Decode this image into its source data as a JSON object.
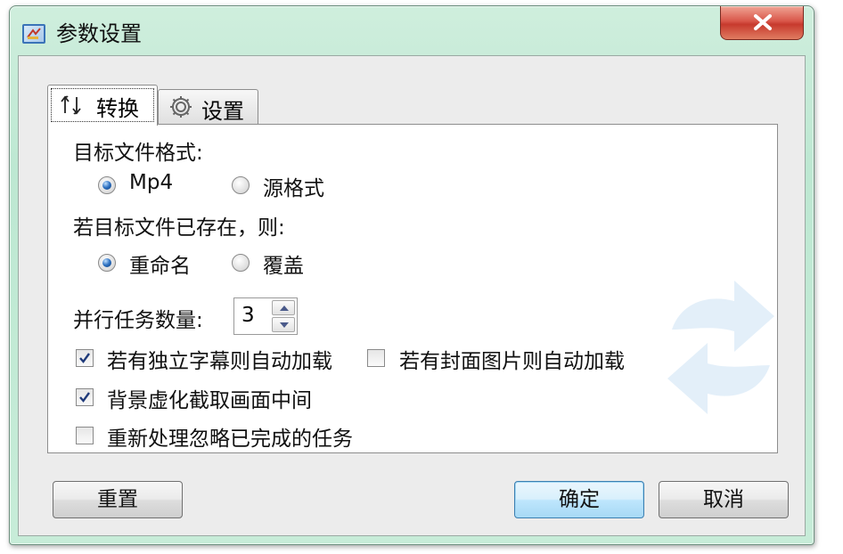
{
  "window": {
    "title": "参数设置"
  },
  "tabs": [
    {
      "label": "转换",
      "icon": "swap-arrows-icon",
      "active": true
    },
    {
      "label": "设置",
      "icon": "gear-icon",
      "active": false
    }
  ],
  "convert": {
    "target_format_label": "目标文件格式:",
    "format_options": [
      {
        "label": "Mp4",
        "checked": true
      },
      {
        "label": "源格式",
        "checked": false
      }
    ],
    "if_exists_label": "若目标文件已存在，则:",
    "exists_options": [
      {
        "label": "重命名",
        "checked": true
      },
      {
        "label": "覆盖",
        "checked": false
      }
    ],
    "parallel_label": "并行任务数量:",
    "parallel_value": "3",
    "checkboxes": [
      {
        "label": "若有独立字幕则自动加载",
        "checked": true
      },
      {
        "label": "若有封面图片则自动加载",
        "checked": false
      },
      {
        "label": "背景虚化截取画面中间",
        "checked": true
      },
      {
        "label": "重新处理忽略已完成的任务",
        "checked": false
      }
    ]
  },
  "buttons": {
    "reset": "重置",
    "ok": "确定",
    "cancel": "取消"
  },
  "colors": {
    "frame": "#bde8d2",
    "close_button": "#d9574a",
    "radio_checked": "#2b6fc0",
    "default_button": "#bee6fd"
  }
}
